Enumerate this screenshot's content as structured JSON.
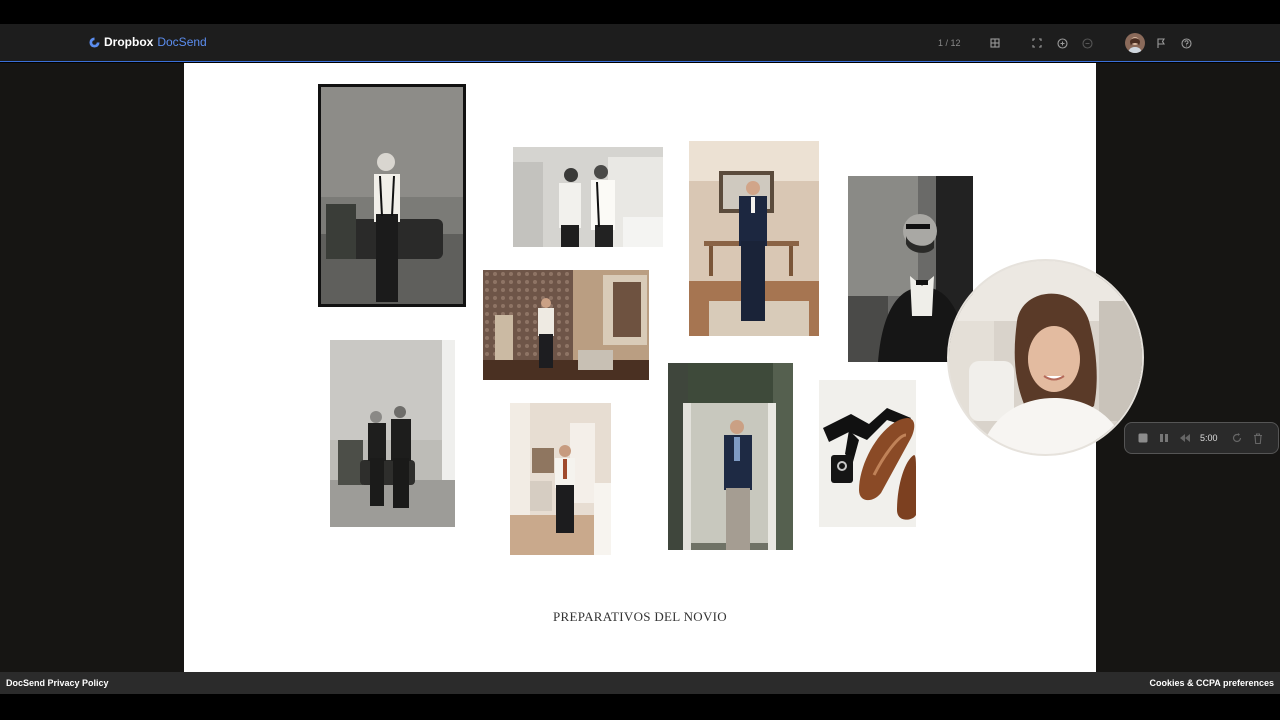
{
  "app": {
    "brand_primary": "Dropbox",
    "brand_secondary": "DocSend",
    "accent": "#3a6fd8"
  },
  "toolbar": {
    "pager": "1 / 12",
    "icons": [
      "grid-icon",
      "fullscreen-icon",
      "zoom-in-icon",
      "zoom-out-icon",
      "flag-icon",
      "help-icon"
    ]
  },
  "slide": {
    "caption": "PREPARATIVOS DEL NOVIO",
    "photos": [
      "groom-suspenders-bw",
      "groom-and-father-bw",
      "groom-navy-suit-portrait",
      "groom-sunglasses-bw",
      "groom-patterned-wallpaper-room",
      "two-men-courtyard-bw",
      "groom-mirror-tie",
      "groom-doorway-navy",
      "bowtie-rings-loafers"
    ]
  },
  "recorder": {
    "time": "5:00"
  },
  "footer": {
    "left_link": "DocSend Privacy Policy",
    "right_link": "Cookies & CCPA preferences"
  }
}
